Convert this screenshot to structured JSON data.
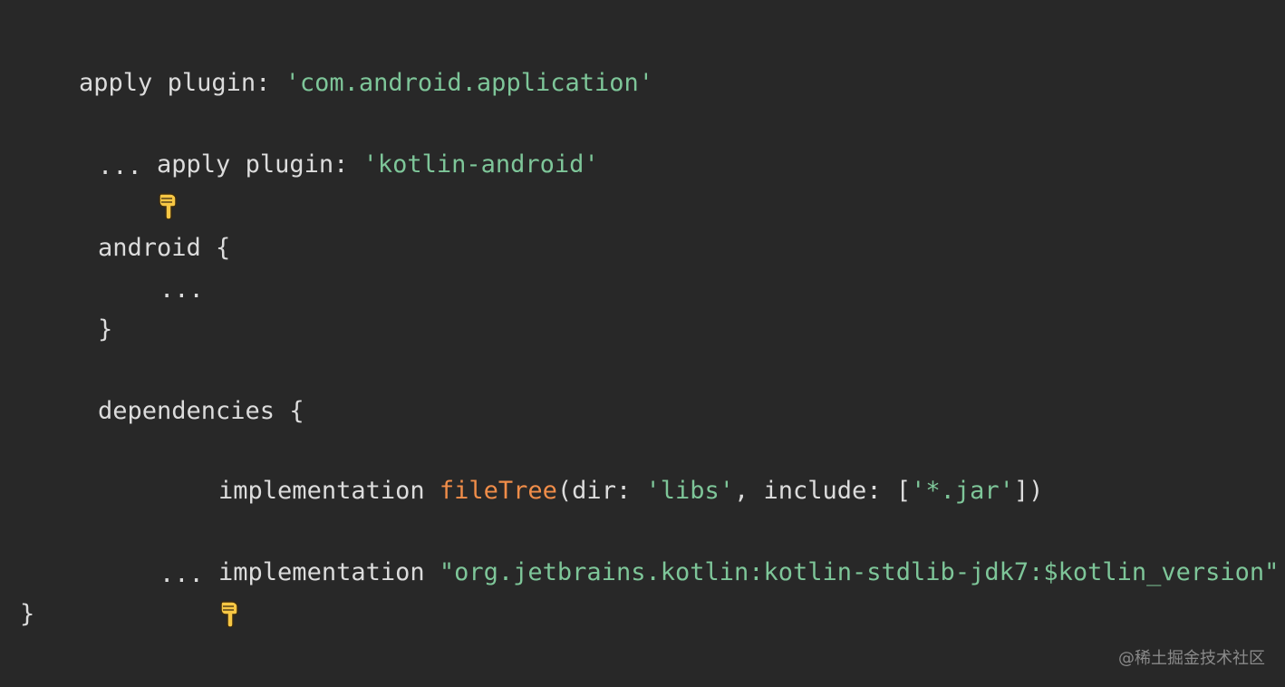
{
  "colors": {
    "background": "#282828",
    "plain": "#dcdcdc",
    "string": "#7ec699",
    "function": "#f08d49",
    "emoji_fill": "#f7c744",
    "watermark": "#8a8a8a"
  },
  "icons": {
    "pointer": "backhand-index-pointing-down-icon"
  },
  "code": {
    "line1": {
      "keyword": "apply plugin: ",
      "value": "'com.android.application'"
    },
    "line3": {
      "keyword": "apply plugin: ",
      "value": "'kotlin-android'"
    },
    "line4": "...",
    "line6": "android {",
    "line7": "...",
    "line8": "}",
    "line10": "dependencies {",
    "line11": {
      "impl": "implementation ",
      "func": "fileTree",
      "open_dir": "(dir: ",
      "dir_value": "'libs'",
      "include": ", include: [",
      "include_value": "'*.jar'",
      "close": "])"
    },
    "line13": {
      "impl": "implementation ",
      "value": "\"org.jetbrains.kotlin:kotlin-stdlib-jdk7:$kotlin_version\""
    },
    "line14": "...",
    "line15": "}"
  },
  "watermark": "@稀土掘金技术社区"
}
